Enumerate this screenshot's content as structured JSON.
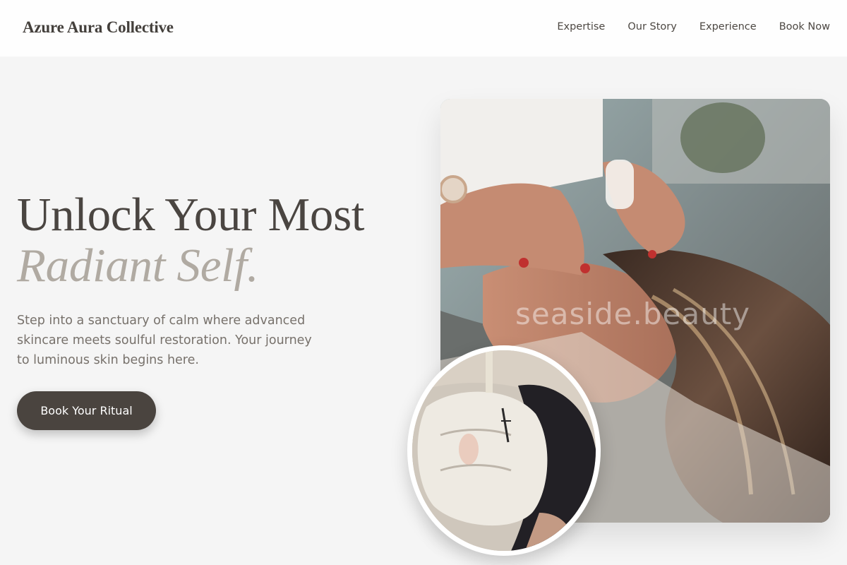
{
  "brand": "Azure Aura Collective",
  "nav": {
    "items": [
      "Expertise",
      "Our Story",
      "Experience",
      "Book Now"
    ]
  },
  "hero": {
    "headline_line1": "Unlock Your Most",
    "headline_line2": "Radiant Self.",
    "subtitle": "Step into a sanctuary of calm where advanced skincare meets soulful restoration. Your journey to luminous skin begins here.",
    "cta_label": "Book Your Ritual"
  },
  "images": {
    "main_watermark": "seaside.beauty",
    "main_alt": "Facial massage treatment",
    "circle_alt": "Facial mask treatment"
  },
  "colors": {
    "background": "#f5f5f5",
    "text_dark": "#4a4541",
    "text_muted": "#b0aaa2",
    "button_bg": "#4a443f"
  }
}
